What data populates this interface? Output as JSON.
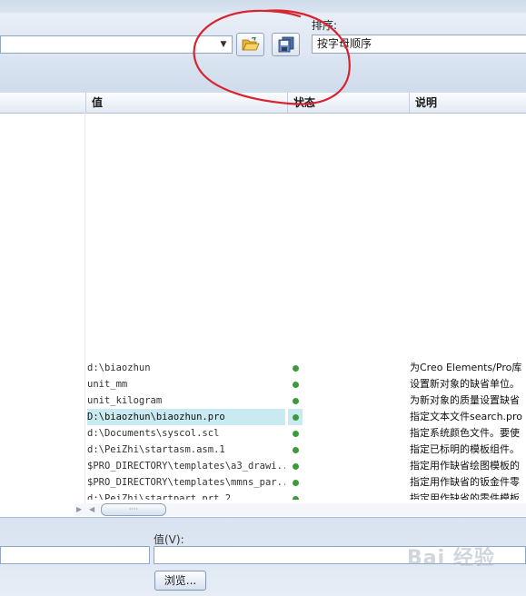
{
  "toolbar": {
    "file_combo_value": "",
    "open_icon": "folder-open-icon",
    "save_icon": "save-icon"
  },
  "sort": {
    "label": "排序:",
    "value": "按字母顺序"
  },
  "table": {
    "headers": {
      "value": "值",
      "status": "状态",
      "description": "说明"
    },
    "rows": [
      {
        "value": "d:\\biaozhun",
        "description": "为Creo Elements/Pro库",
        "selected": false
      },
      {
        "value": "unit_mm",
        "description": "设置新对象的缺省单位。",
        "selected": false
      },
      {
        "value": "unit_kilogram",
        "description": "为新对象的质量设置缺省",
        "selected": false
      },
      {
        "value": "D:\\biaozhun\\biaozhun.pro",
        "description": "指定文本文件search.pro",
        "selected": true
      },
      {
        "value": "d:\\Documents\\syscol.scl",
        "description": "指定系统颜色文件。要使",
        "selected": false
      },
      {
        "value": "d:\\PeiZhi\\startasm.asm.1",
        "description": "指定已标明的模板组件。",
        "selected": false
      },
      {
        "value": "$PRO_DIRECTORY\\templates\\a3_drawi...",
        "description": "指定用作缺省绘图模板的",
        "selected": false
      },
      {
        "value": "$PRO_DIRECTORY\\templates\\mmns_par...",
        "description": "指定用作缺省的钣金件零",
        "selected": false
      },
      {
        "value": "d:\\PeiZhi\\startpart.prt.2",
        "description": "指定用作缺省的零件模板",
        "selected": false
      }
    ],
    "status_color": "#3c9a3c"
  },
  "scrollbar": {
    "thumb_grip": "····"
  },
  "bottom": {
    "value_label": "值(V):",
    "name_input_value": "",
    "value_input_value": "",
    "browse_button": "浏览..."
  },
  "watermark": "Bai 经验",
  "colors": {
    "selected_row": "#c8eaf0",
    "annotation": "#d9232f"
  }
}
